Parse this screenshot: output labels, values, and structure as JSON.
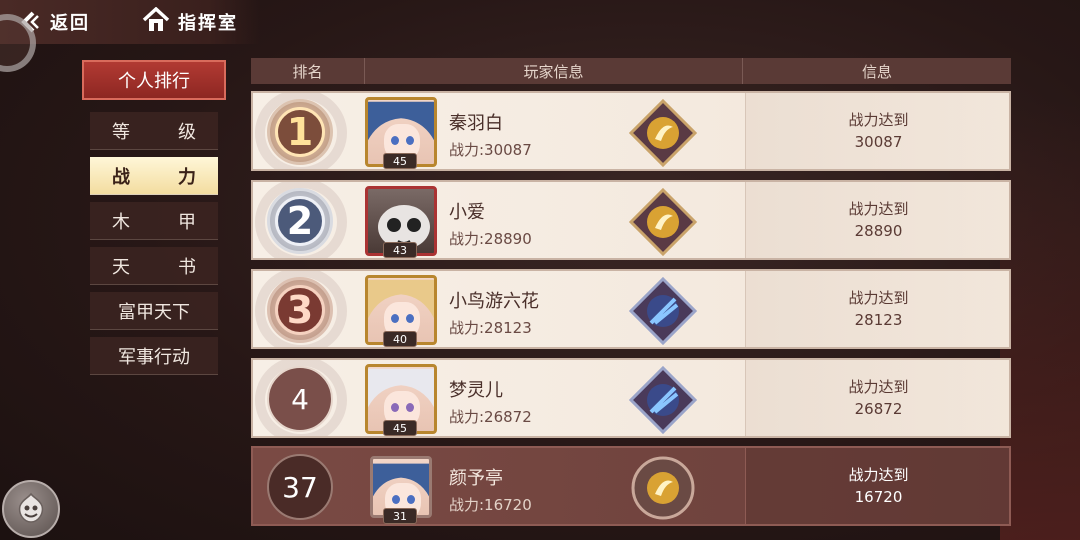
{
  "nav": {
    "back_label": "返回",
    "home_label": "指挥室"
  },
  "sidebar": {
    "header": "个人排行",
    "items": [
      {
        "label": "等级",
        "c1": "等",
        "c2": "级",
        "active": false
      },
      {
        "label": "战力",
        "c1": "战",
        "c2": "力",
        "active": true
      },
      {
        "label": "木甲",
        "c1": "木",
        "c2": "甲",
        "active": false
      },
      {
        "label": "天书",
        "c1": "天",
        "c2": "书",
        "active": false
      },
      {
        "label": "富甲天下",
        "active": false
      },
      {
        "label": "军事行动",
        "active": false
      }
    ]
  },
  "table": {
    "headers": {
      "rank": "排名",
      "player": "玩家信息",
      "info": "信息"
    },
    "rows": [
      {
        "rank": "1",
        "name": "秦羽白",
        "power": "战力:30087",
        "level": "45",
        "info_title": "战力达到",
        "info_value": "30087",
        "medal": "gold",
        "emblem": "gold-seal-icon"
      },
      {
        "rank": "2",
        "name": "小爱",
        "power": "战力:28890",
        "level": "43",
        "info_title": "战力达到",
        "info_value": "28890",
        "medal": "silver",
        "emblem": "gold-seal-icon"
      },
      {
        "rank": "3",
        "name": "小鸟游六花",
        "power": "战力:28123",
        "level": "40",
        "info_title": "战力达到",
        "info_value": "28123",
        "medal": "bronze",
        "emblem": "blue-swords-icon"
      },
      {
        "rank": "4",
        "name": "梦灵儿",
        "power": "战力:26872",
        "level": "45",
        "info_title": "战力达到",
        "info_value": "26872",
        "medal": "plain",
        "emblem": "blue-swords-icon"
      },
      {
        "rank": "37",
        "name": "颜予亭",
        "power": "战力:16720",
        "level": "31",
        "info_title": "战力达到",
        "info_value": "16720",
        "medal": "self",
        "emblem": "gold-seal-icon"
      }
    ]
  },
  "colors": {
    "accent_red": "#b23a33",
    "active_tab": "#f3dda0",
    "row_bg": "#f7efe6",
    "self_row_bg": "#7a4a44"
  }
}
